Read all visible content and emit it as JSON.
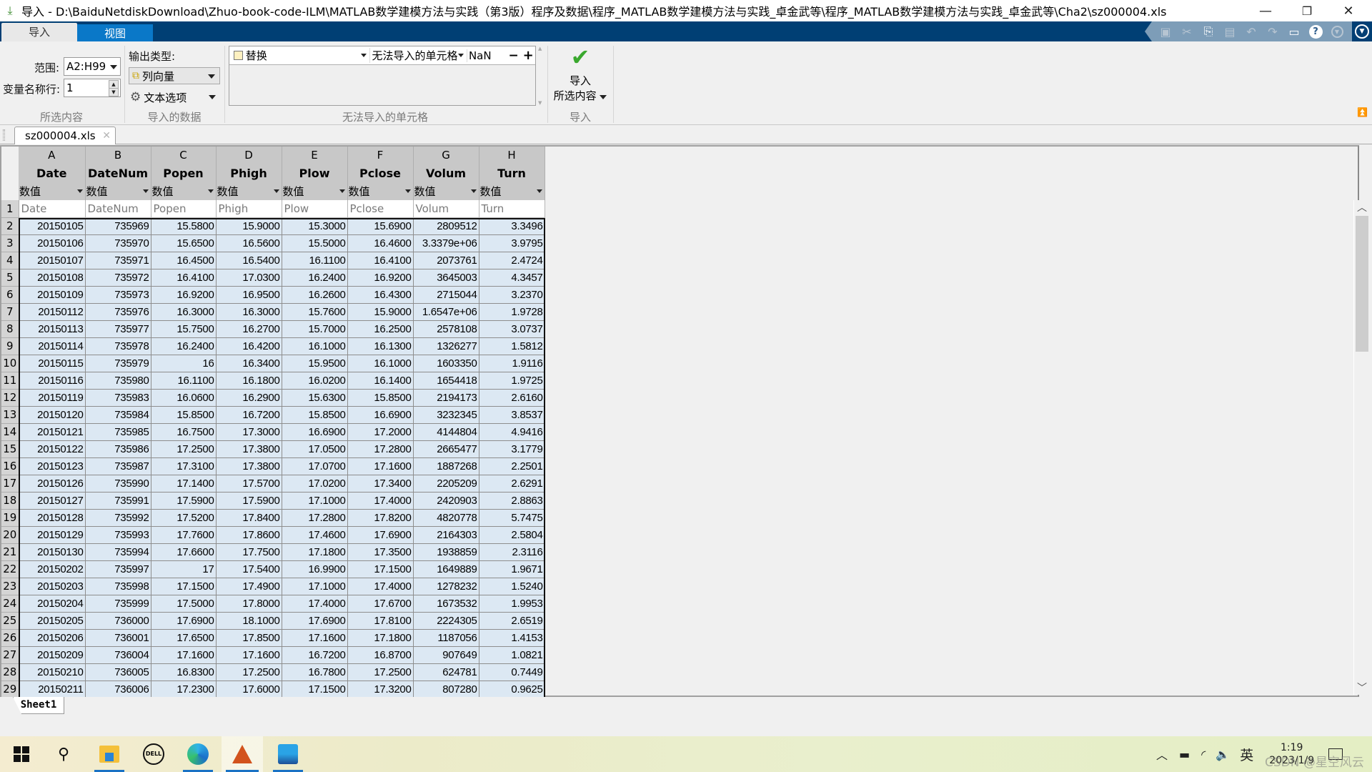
{
  "window": {
    "title": "导入 - D:\\BaiduNetdiskDownload\\Zhuo-book-code-ILM\\MATLAB数学建模方法与实践（第3版）程序及数据\\程序_MATLAB数学建模方法与实践_卓金武等\\程序_MATLAB数学建模方法与实践_卓金武等\\Cha2\\sz000004.xls",
    "app_icon": "import-arrow-icon",
    "controls": {
      "minimize": "—",
      "restore": "❐",
      "close": "✕"
    }
  },
  "ribbon_tabs": [
    {
      "label": "导入",
      "active": true
    },
    {
      "label": "视图",
      "active": false
    }
  ],
  "quick_access": [
    {
      "icon": "save-icon",
      "glyph": "💾",
      "enabled": false
    },
    {
      "icon": "cut-icon",
      "glyph": "✂",
      "enabled": false
    },
    {
      "icon": "copy-icon",
      "glyph": "⎘",
      "enabled": true
    },
    {
      "icon": "paste-icon",
      "glyph": "📋",
      "enabled": false
    },
    {
      "icon": "undo-icon",
      "glyph": "↶",
      "enabled": false
    },
    {
      "icon": "redo-icon",
      "glyph": "↷",
      "enabled": false
    },
    {
      "icon": "window-layout-icon",
      "glyph": "▤",
      "enabled": true
    },
    {
      "icon": "help-icon",
      "glyph": "?",
      "enabled": true
    },
    {
      "icon": "options-icon",
      "glyph": "▾",
      "enabled": false
    }
  ],
  "ribbon": {
    "selection": {
      "range_label": "范围:",
      "range_value": "A2:H99",
      "varname_row_label": "变量名称行:",
      "varname_row_value": "1",
      "group_label": "所选内容"
    },
    "imported_data": {
      "output_type_label": "输出类型:",
      "output_type_value": "列向量",
      "text_options_label": "文本选项",
      "group_label": "导入的数据"
    },
    "unimportable": {
      "rule_action": "替换",
      "rule_target": "无法导入的单元格",
      "rule_value": "NaN",
      "remove_label": "−",
      "add_label": "+",
      "group_label": "无法导入的单元格"
    },
    "import": {
      "button_line1": "导入",
      "button_line2": "所选内容",
      "group_label": "导入"
    }
  },
  "document_tab": {
    "label": "sz000004.xls",
    "close": "✕"
  },
  "grid": {
    "columns": [
      {
        "letter": "A",
        "name": "Date",
        "type": "数值",
        "varname": "Date"
      },
      {
        "letter": "B",
        "name": "DateNum",
        "type": "数值",
        "varname": "DateNum"
      },
      {
        "letter": "C",
        "name": "Popen",
        "type": "数值",
        "varname": "Popen"
      },
      {
        "letter": "D",
        "name": "Phigh",
        "type": "数值",
        "varname": "Phigh"
      },
      {
        "letter": "E",
        "name": "Plow",
        "type": "数值",
        "varname": "Plow"
      },
      {
        "letter": "F",
        "name": "Pclose",
        "type": "数值",
        "varname": "Pclose"
      },
      {
        "letter": "G",
        "name": "Volum",
        "type": "数值",
        "varname": "Volum"
      },
      {
        "letter": "H",
        "name": "Turn",
        "type": "数值",
        "varname": "Turn"
      }
    ],
    "varname_row_number": "1",
    "rows": [
      {
        "n": "2",
        "cells": [
          "20150105",
          "735969",
          "15.5800",
          "15.9000",
          "15.3000",
          "15.6900",
          "2809512",
          "3.3496"
        ]
      },
      {
        "n": "3",
        "cells": [
          "20150106",
          "735970",
          "15.6500",
          "16.5600",
          "15.5000",
          "16.4600",
          "3.3379e+06",
          "3.9795"
        ]
      },
      {
        "n": "4",
        "cells": [
          "20150107",
          "735971",
          "16.4500",
          "16.5400",
          "16.1100",
          "16.4100",
          "2073761",
          "2.4724"
        ]
      },
      {
        "n": "5",
        "cells": [
          "20150108",
          "735972",
          "16.4100",
          "17.0300",
          "16.2400",
          "16.9200",
          "3645003",
          "4.3457"
        ]
      },
      {
        "n": "6",
        "cells": [
          "20150109",
          "735973",
          "16.9200",
          "16.9500",
          "16.2600",
          "16.4300",
          "2715044",
          "3.2370"
        ]
      },
      {
        "n": "7",
        "cells": [
          "20150112",
          "735976",
          "16.3000",
          "16.3000",
          "15.7600",
          "15.9000",
          "1.6547e+06",
          "1.9728"
        ]
      },
      {
        "n": "8",
        "cells": [
          "20150113",
          "735977",
          "15.7500",
          "16.2700",
          "15.7000",
          "16.2500",
          "2578108",
          "3.0737"
        ]
      },
      {
        "n": "9",
        "cells": [
          "20150114",
          "735978",
          "16.2400",
          "16.4200",
          "16.1000",
          "16.1300",
          "1326277",
          "1.5812"
        ]
      },
      {
        "n": "10",
        "cells": [
          "20150115",
          "735979",
          "16",
          "16.3400",
          "15.9500",
          "16.1000",
          "1603350",
          "1.9116"
        ]
      },
      {
        "n": "11",
        "cells": [
          "20150116",
          "735980",
          "16.1100",
          "16.1800",
          "16.0200",
          "16.1400",
          "1654418",
          "1.9725"
        ]
      },
      {
        "n": "12",
        "cells": [
          "20150119",
          "735983",
          "16.0600",
          "16.2900",
          "15.6300",
          "15.8500",
          "2194173",
          "2.6160"
        ]
      },
      {
        "n": "13",
        "cells": [
          "20150120",
          "735984",
          "15.8500",
          "16.7200",
          "15.8500",
          "16.6900",
          "3232345",
          "3.8537"
        ]
      },
      {
        "n": "14",
        "cells": [
          "20150121",
          "735985",
          "16.7500",
          "17.3000",
          "16.6900",
          "17.2000",
          "4144804",
          "4.9416"
        ]
      },
      {
        "n": "15",
        "cells": [
          "20150122",
          "735986",
          "17.2500",
          "17.3800",
          "17.0500",
          "17.2800",
          "2665477",
          "3.1779"
        ]
      },
      {
        "n": "16",
        "cells": [
          "20150123",
          "735987",
          "17.3100",
          "17.3800",
          "17.0700",
          "17.1600",
          "1887268",
          "2.2501"
        ]
      },
      {
        "n": "17",
        "cells": [
          "20150126",
          "735990",
          "17.1400",
          "17.5700",
          "17.0200",
          "17.3400",
          "2205209",
          "2.6291"
        ]
      },
      {
        "n": "18",
        "cells": [
          "20150127",
          "735991",
          "17.5900",
          "17.5900",
          "17.1000",
          "17.4000",
          "2420903",
          "2.8863"
        ]
      },
      {
        "n": "19",
        "cells": [
          "20150128",
          "735992",
          "17.5200",
          "17.8400",
          "17.2800",
          "17.8200",
          "4820778",
          "5.7475"
        ]
      },
      {
        "n": "20",
        "cells": [
          "20150129",
          "735993",
          "17.7600",
          "17.8600",
          "17.4600",
          "17.6900",
          "2164303",
          "2.5804"
        ]
      },
      {
        "n": "21",
        "cells": [
          "20150130",
          "735994",
          "17.6600",
          "17.7500",
          "17.1800",
          "17.3500",
          "1938859",
          "2.3116"
        ]
      },
      {
        "n": "22",
        "cells": [
          "20150202",
          "735997",
          "17",
          "17.5400",
          "16.9900",
          "17.1500",
          "1649889",
          "1.9671"
        ]
      },
      {
        "n": "23",
        "cells": [
          "20150203",
          "735998",
          "17.1500",
          "17.4900",
          "17.1000",
          "17.4000",
          "1278232",
          "1.5240"
        ]
      },
      {
        "n": "24",
        "cells": [
          "20150204",
          "735999",
          "17.5000",
          "17.8000",
          "17.4000",
          "17.6700",
          "1673532",
          "1.9953"
        ]
      },
      {
        "n": "25",
        "cells": [
          "20150205",
          "736000",
          "17.6900",
          "18.1000",
          "17.6900",
          "17.8100",
          "2224305",
          "2.6519"
        ]
      },
      {
        "n": "26",
        "cells": [
          "20150206",
          "736001",
          "17.6500",
          "17.8500",
          "17.1600",
          "17.1800",
          "1187056",
          "1.4153"
        ]
      },
      {
        "n": "27",
        "cells": [
          "20150209",
          "736004",
          "17.1600",
          "17.1600",
          "16.7200",
          "16.8700",
          "907649",
          "1.0821"
        ]
      },
      {
        "n": "28",
        "cells": [
          "20150210",
          "736005",
          "16.8300",
          "17.2500",
          "16.7800",
          "17.2500",
          "624781",
          "0.7449"
        ]
      },
      {
        "n": "29",
        "cells": [
          "20150211",
          "736006",
          "17.2300",
          "17.6000",
          "17.1500",
          "17.3200",
          "807280",
          "0.9625"
        ]
      }
    ]
  },
  "sheet_tabs": [
    {
      "label": "Sheet1",
      "active": true
    }
  ],
  "taskbar": {
    "apps": [
      {
        "name": "start",
        "icon": "windows-start-icon",
        "running": false
      },
      {
        "name": "search",
        "icon": "search-icon",
        "running": false
      },
      {
        "name": "file-explorer",
        "icon": "folder-icon",
        "running": true
      },
      {
        "name": "dell",
        "icon": "dell-icon",
        "running": false
      },
      {
        "name": "edge",
        "icon": "edge-browser-icon",
        "running": true
      },
      {
        "name": "matlab",
        "icon": "matlab-icon",
        "running": true,
        "active": true
      },
      {
        "name": "photos",
        "icon": "photos-icon",
        "running": true
      }
    ],
    "tray": {
      "ime": "英",
      "time": "1:19",
      "date": "2023/1/9",
      "watermark": "CSDN @星空风云"
    }
  },
  "colors": {
    "ribbon_bar": "#003f74",
    "tab_inactive": "#0a78c8",
    "selected_cell": "#dce8f3",
    "header_gray": "#c8c8c8"
  }
}
